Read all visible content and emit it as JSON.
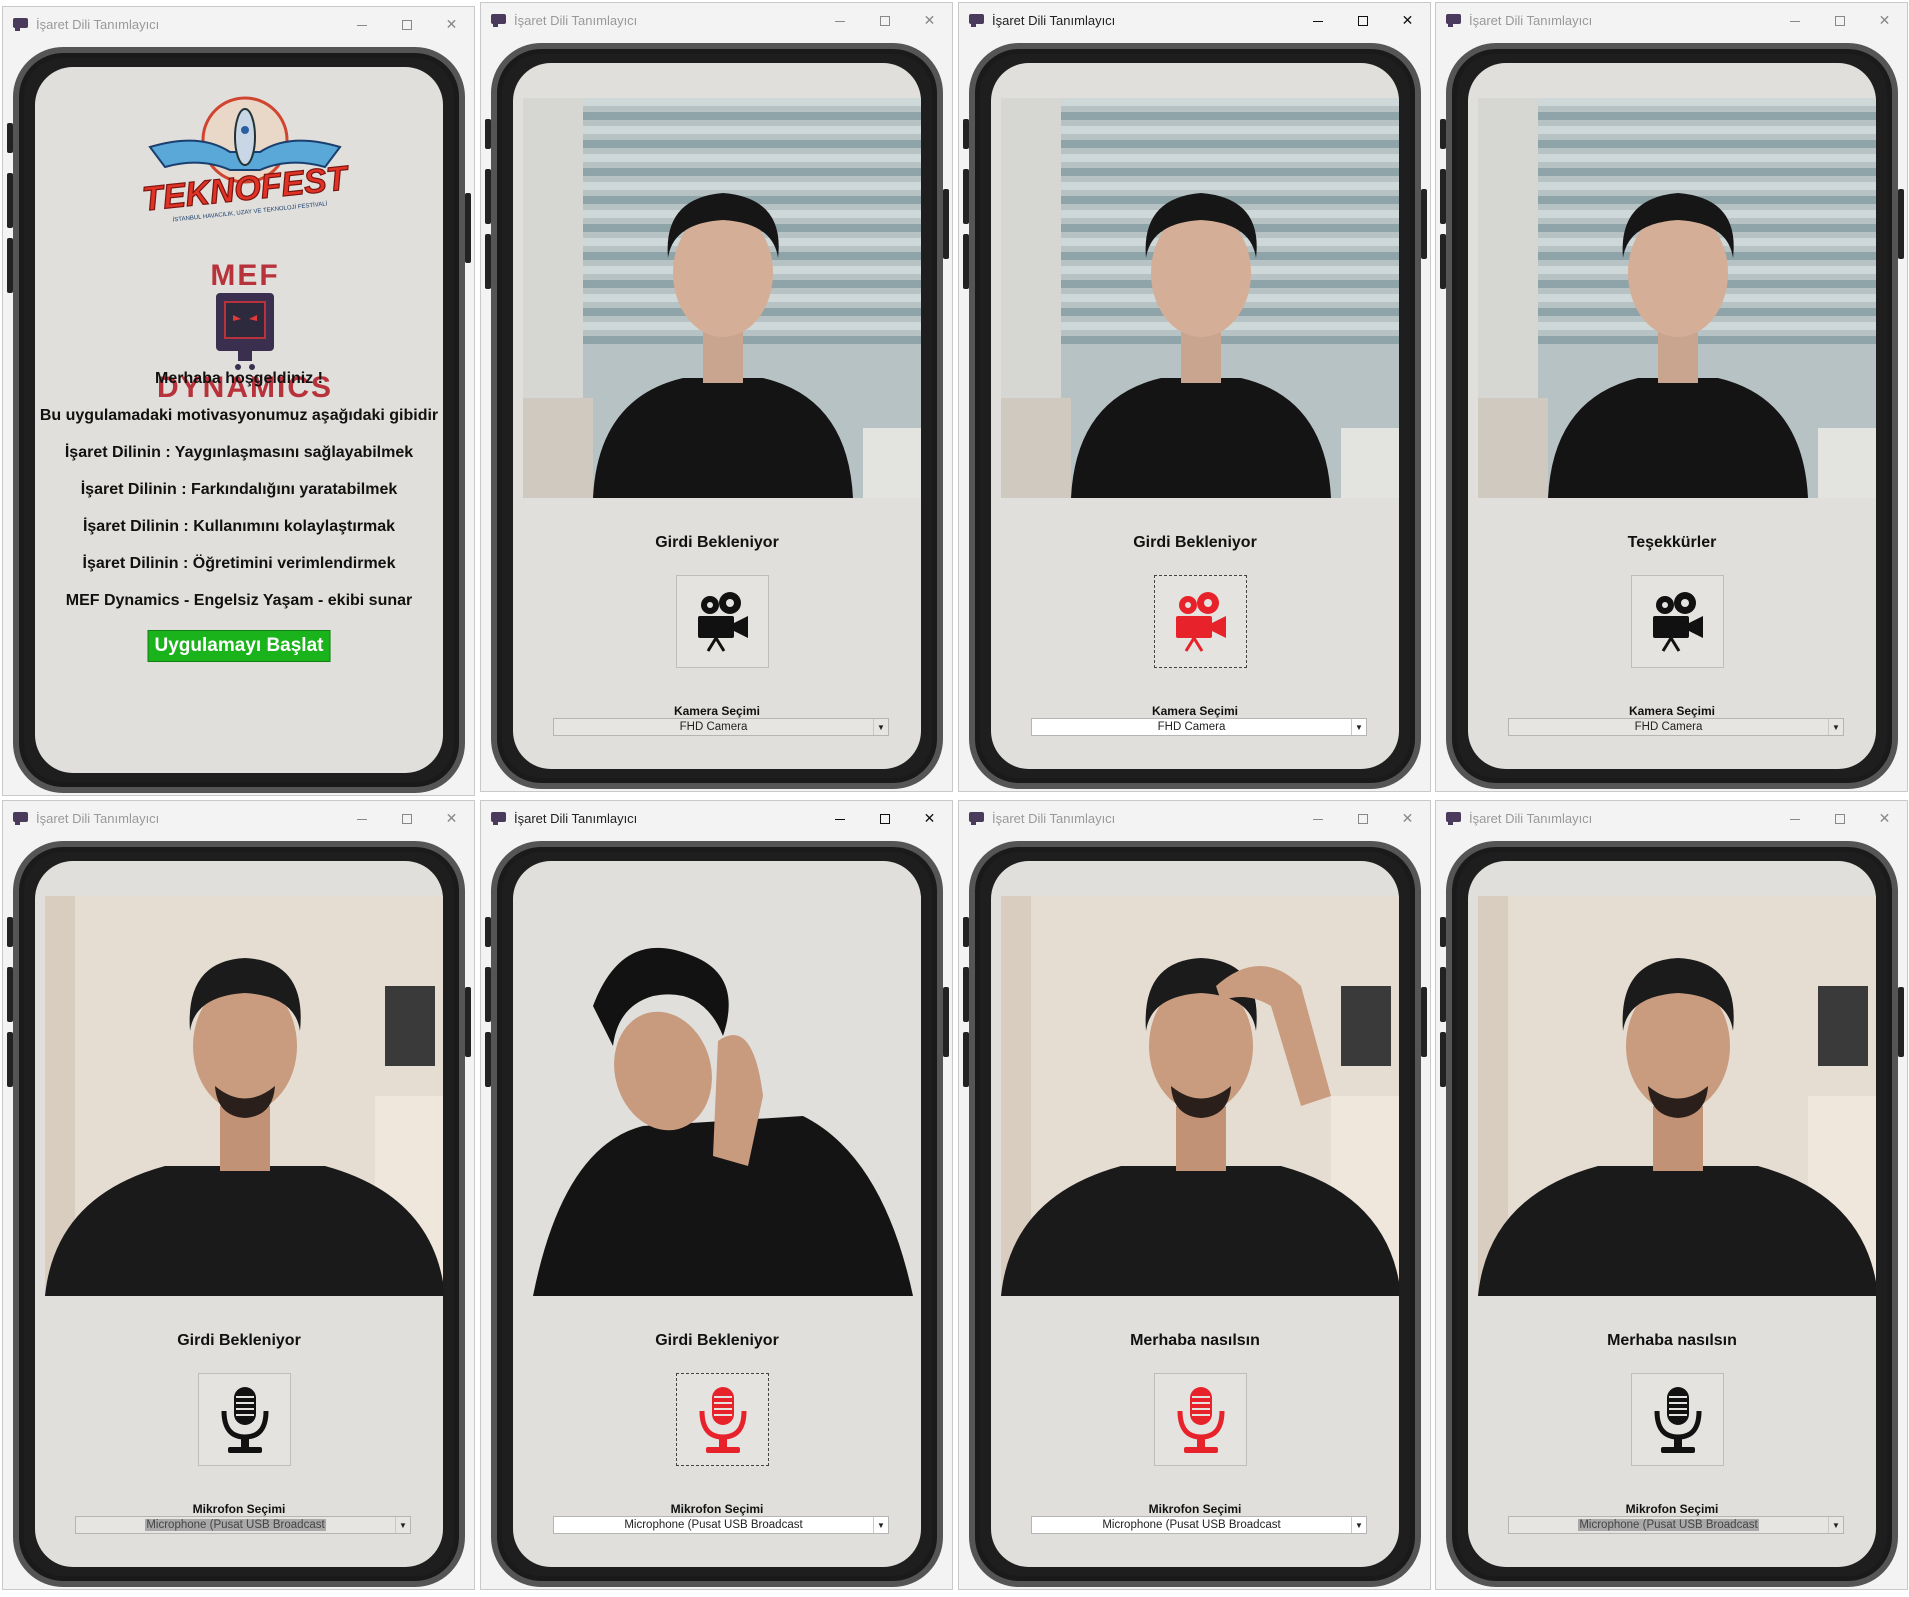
{
  "window_title": "İşaret Dili Tanımlayıcı",
  "controls": {
    "minimize": "—",
    "close": "✕"
  },
  "intro": {
    "logo_teknofest_text": "TEKNOFEST",
    "logo_teknofest_sub": "İSTANBUL HAVACILIK, UZAY VE TEKNOLOJİ FESTİVALİ",
    "logo_mef_top": "MEF",
    "logo_mef_bottom": "DYNAMICS",
    "lines": [
      "Merhaba hoşgeldiniz !",
      "Bu uygulamadaki motivasyonumuz aşağıdaki gibidir",
      "İşaret Dilinin : Yaygınlaşmasını sağlayabilmek",
      "İşaret Dilinin : Farkındalığını yaratabilmek",
      "İşaret Dilinin : Kullanımını kolaylaştırmak",
      "İşaret Dilinin : Öğretimini verimlendirmek",
      "MEF Dynamics - Engelsiz Yaşam - ekibi sunar"
    ],
    "start_button": "Uygulamayı Başlat"
  },
  "screens": [
    {
      "status": "Girdi Bekleniyor",
      "select_label": "Kamera Seçimi",
      "select_value": "FHD Camera",
      "icon": "camera-icon",
      "icon_color": "#111111"
    },
    {
      "status": "Girdi Bekleniyor",
      "select_label": "Kamera Seçimi",
      "select_value": "FHD Camera",
      "icon": "camera-icon",
      "icon_color": "#e8222b"
    },
    {
      "status": "Teşekkürler",
      "select_label": "Kamera Seçimi",
      "select_value": "FHD Camera",
      "icon": "camera-icon",
      "icon_color": "#111111"
    },
    {
      "status": "Girdi Bekleniyor",
      "select_label": "Mikrofon Seçimi",
      "select_value": "Microphone (Pusat USB Broadcast",
      "icon": "microphone-icon",
      "icon_color": "#111111"
    },
    {
      "status": "Girdi Bekleniyor",
      "select_label": "Mikrofon Seçimi",
      "select_value": "Microphone (Pusat USB Broadcast",
      "icon": "microphone-icon",
      "icon_color": "#e8222b"
    },
    {
      "status": "Merhaba nasılsın",
      "select_label": "Mikrofon Seçimi",
      "select_value": "Microphone (Pusat USB Broadcast",
      "icon": "microphone-icon",
      "icon_color": "#e8222b"
    },
    {
      "status": "Merhaba nasılsın",
      "select_label": "Mikrofon Seçimi",
      "select_value": "Microphone (Pusat USB Broadcast",
      "icon": "microphone-icon",
      "icon_color": "#111111"
    }
  ],
  "colors": {
    "accent_green": "#1bb31b",
    "active_red": "#e8222b",
    "screen_bg": "#e0dfdb"
  }
}
